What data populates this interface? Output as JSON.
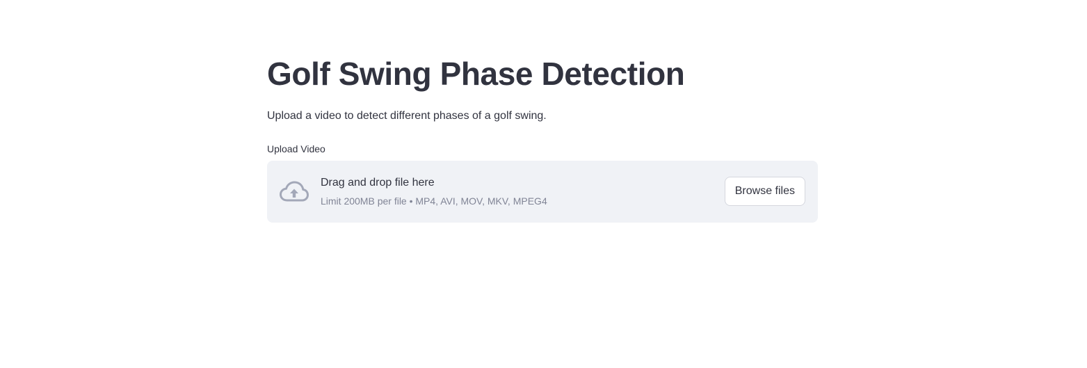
{
  "header": {
    "title": "Golf Swing Phase Detection",
    "subtitle": "Upload a video to detect different phases of a golf swing."
  },
  "uploader": {
    "label": "Upload Video",
    "drop_text": "Drag and drop file here",
    "limit_text": "Limit 200MB per file • MP4, AVI, MOV, MKV, MPEG4",
    "browse_label": "Browse files",
    "icon": "cloud-upload-icon"
  },
  "colors": {
    "text": "#31333f",
    "muted": "#808495",
    "dropzone_bg": "#f0f2f6",
    "icon": "#a3a8b8"
  }
}
